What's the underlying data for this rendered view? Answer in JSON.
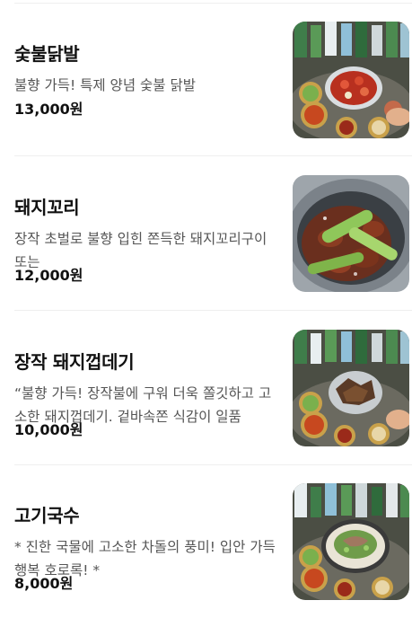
{
  "menu_items": [
    {
      "name": "숯불닭발",
      "description": "불향 가득! 특제 양념 숯불 닭발",
      "price": "13,000원",
      "image_icon": "chicken-feet-dish-photo"
    },
    {
      "name": "돼지꼬리",
      "description": "장작 초벌로 불향 입힌 쫀득한 돼지꼬리구이 또는",
      "price": "12,000원",
      "image_icon": "pork-tail-dish-photo"
    },
    {
      "name": "장작 돼지껍데기",
      "description": "“불향 가득! 장작불에 구워 더욱 쫄깃하고 고소한 돼지껍데기. 겉바속쫀 식감이 일품",
      "price": "10,000원",
      "image_icon": "pork-skin-dish-photo"
    },
    {
      "name": "고기국수",
      "description": "* 진한 국물에 고소한 차돌의 풍미! 입안 가득 행복 호로록! *",
      "price": "8,000원",
      "image_icon": "noodle-soup-dish-photo"
    }
  ]
}
